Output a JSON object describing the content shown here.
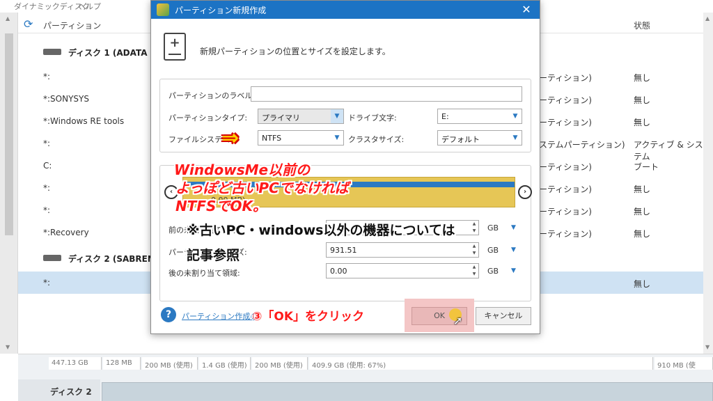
{
  "app": {
    "menu": [
      "ダイナミックディスク",
      "ヘルプ"
    ],
    "header": {
      "partition": "パーティション",
      "status": "状態"
    },
    "rows": [
      {
        "type": "disk",
        "name": "ディスク 1 (ADATA SU6",
        "fs": "",
        "status": ""
      },
      {
        "type": "part",
        "name": "*:",
        "fs": "ーティション)",
        "status": "無し"
      },
      {
        "type": "part",
        "name": "*:SONYSYS",
        "fs": "ーティション)",
        "status": "無し"
      },
      {
        "type": "part",
        "name": "*:Windows RE tools",
        "fs": "ーティション)",
        "status": "無し"
      },
      {
        "type": "part",
        "name": "*:",
        "fs": "ステムパーティション)",
        "status": "アクティブ & システム"
      },
      {
        "type": "part",
        "name": "C:",
        "fs": "ーティション)",
        "status": "ブート"
      },
      {
        "type": "part",
        "name": "*:",
        "fs": "ーティション)",
        "status": "無し"
      },
      {
        "type": "part",
        "name": "*:",
        "fs": "ーティション)",
        "status": "無し"
      },
      {
        "type": "part",
        "name": "*:Recovery",
        "fs": "ーティション)",
        "status": "無し"
      },
      {
        "type": "disk",
        "name": "ディスク 2 (SABRENT U",
        "fs": "",
        "status": ""
      },
      {
        "type": "selected",
        "name": "*:",
        "fs": "",
        "status": "無し"
      }
    ],
    "disk_map": {
      "size": "447.13 GB",
      "cells": [
        "128 MB",
        "200 MB (使用)",
        "1.4 GB (使用)",
        "200 MB (使用)",
        "409.9 GB (使用: 67%)",
        "910 MB (使"
      ],
      "disk2_label": "ディスク 2"
    }
  },
  "dialog": {
    "title": "パーティション新規作成",
    "close": "✕",
    "description": "新規パーティションの位置とサイズを設定します。",
    "label_field": {
      "label": "パーティションのラベル:",
      "value": ""
    },
    "partition_type": {
      "label": "パーティションタイプ:",
      "value": "プライマリ"
    },
    "drive_letter": {
      "label": "ドライブ文字:",
      "value": "E:"
    },
    "file_system": {
      "label": "ファイルシステム:",
      "value": "NTFS"
    },
    "cluster_size": {
      "label": "クラスタサイズ:",
      "value": "デフォルト"
    },
    "map_info": "0.00 MB)",
    "before_unalloc": {
      "label": "前の未割り当て領域:",
      "value": "",
      "unit": "GB"
    },
    "partition_size": {
      "label": "パーティションサイズ:",
      "value": "931.51",
      "unit": "GB"
    },
    "after_unalloc": {
      "label": "後の未割り当て領域:",
      "value": "0.00",
      "unit": "GB"
    },
    "help_link": "パーティション作成の",
    "ok": "OK",
    "cancel": "キャンセル"
  },
  "annotations": {
    "arrow": "⇒",
    "red_lines": [
      "WindowsMe以前の",
      "よっぽど古いPCでなければ",
      "NTFSでOK。"
    ],
    "black_lines": [
      "※古いPC・windows以外の機器については",
      "記事参照"
    ],
    "step3": "③「OK」をクリック"
  }
}
